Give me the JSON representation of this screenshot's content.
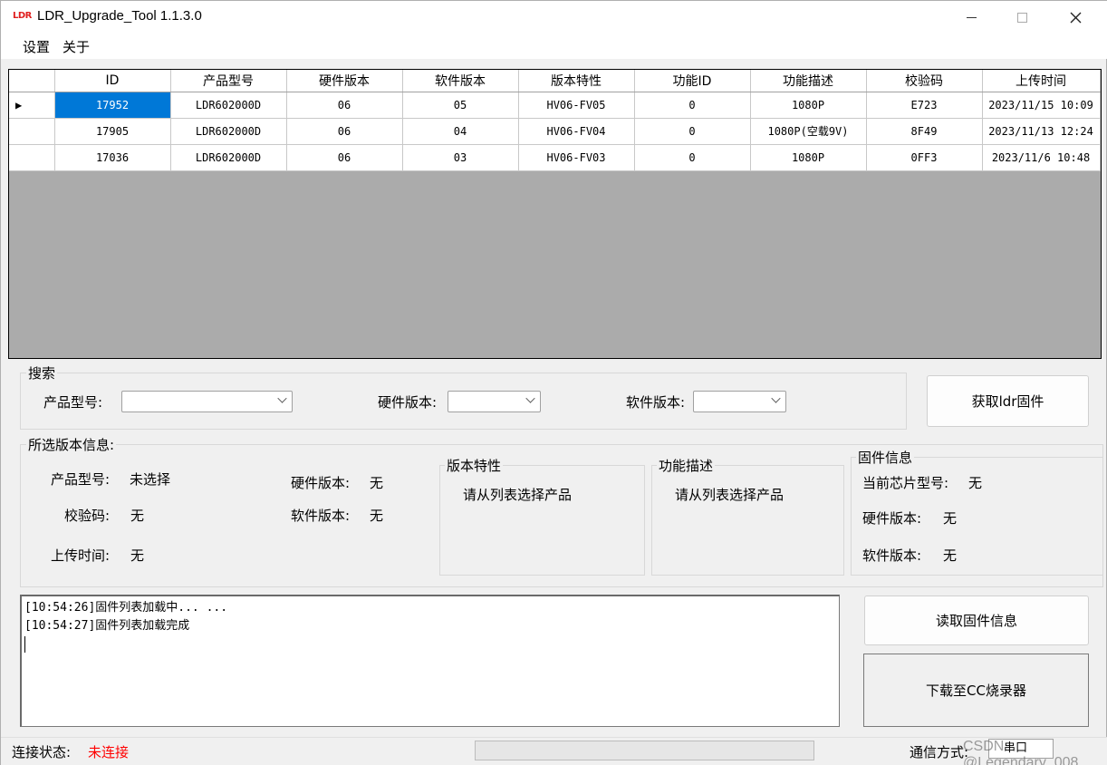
{
  "window": {
    "logo": "LDR",
    "title": "LDR_Upgrade_Tool  1.1.3.0"
  },
  "menu": {
    "settings": "设置",
    "about": "关于"
  },
  "grid": {
    "columns": [
      "ID",
      "产品型号",
      "硬件版本",
      "软件版本",
      "版本特性",
      "功能ID",
      "功能描述",
      "校验码",
      "上传时间"
    ],
    "rows": [
      [
        "17952",
        "LDR602000D",
        "06",
        "05",
        "HV06-FV05",
        "0",
        "1080P",
        "E723",
        "2023/11/15 10:09"
      ],
      [
        "17905",
        "LDR602000D",
        "06",
        "04",
        "HV06-FV04",
        "0",
        "1080P(空载9V)",
        "8F49",
        "2023/11/13 12:24"
      ],
      [
        "17036",
        "LDR602000D",
        "06",
        "03",
        "HV06-FV03",
        "0",
        "1080P",
        "0FF3",
        "2023/11/6 10:48"
      ]
    ],
    "selected_row": 0
  },
  "search": {
    "title": "搜索",
    "product_label": "产品型号:",
    "hw_label": "硬件版本:",
    "sw_label": "软件版本:",
    "product_value": "",
    "hw_value": "",
    "sw_value": ""
  },
  "buttons": {
    "fetch": "获取ldr固件",
    "read_info": "读取固件信息",
    "download": "下载至CC烧录器"
  },
  "selected_info": {
    "title": "所选版本信息:",
    "product_label": "产品型号:",
    "product_value": "未选择",
    "checksum_label": "校验码:",
    "checksum_value": "无",
    "upload_label": "上传时间:",
    "upload_value": "无",
    "hw_label": "硬件版本:",
    "hw_value": "无",
    "sw_label": "软件版本:",
    "sw_value": "无"
  },
  "version_feature": {
    "title": "版本特性",
    "text": "请从列表选择产品"
  },
  "function_desc": {
    "title": "功能描述",
    "text": "请从列表选择产品"
  },
  "firmware_info": {
    "title": "固件信息",
    "chip_label": "当前芯片型号:",
    "chip_value": "无",
    "hw_label": "硬件版本:",
    "hw_value": "无",
    "sw_label": "软件版本:",
    "sw_value": "无"
  },
  "log": {
    "lines": [
      "[10:54:26]固件列表加载中... ...",
      "[10:54:27]固件列表加载完成"
    ]
  },
  "status": {
    "conn_label": "连接状态:",
    "conn_value": "未连接",
    "conn_color": "#ff0000",
    "comm_label": "通信方式:",
    "comm_value": "串口",
    "watermark": "CSDN @Legendary_008"
  }
}
